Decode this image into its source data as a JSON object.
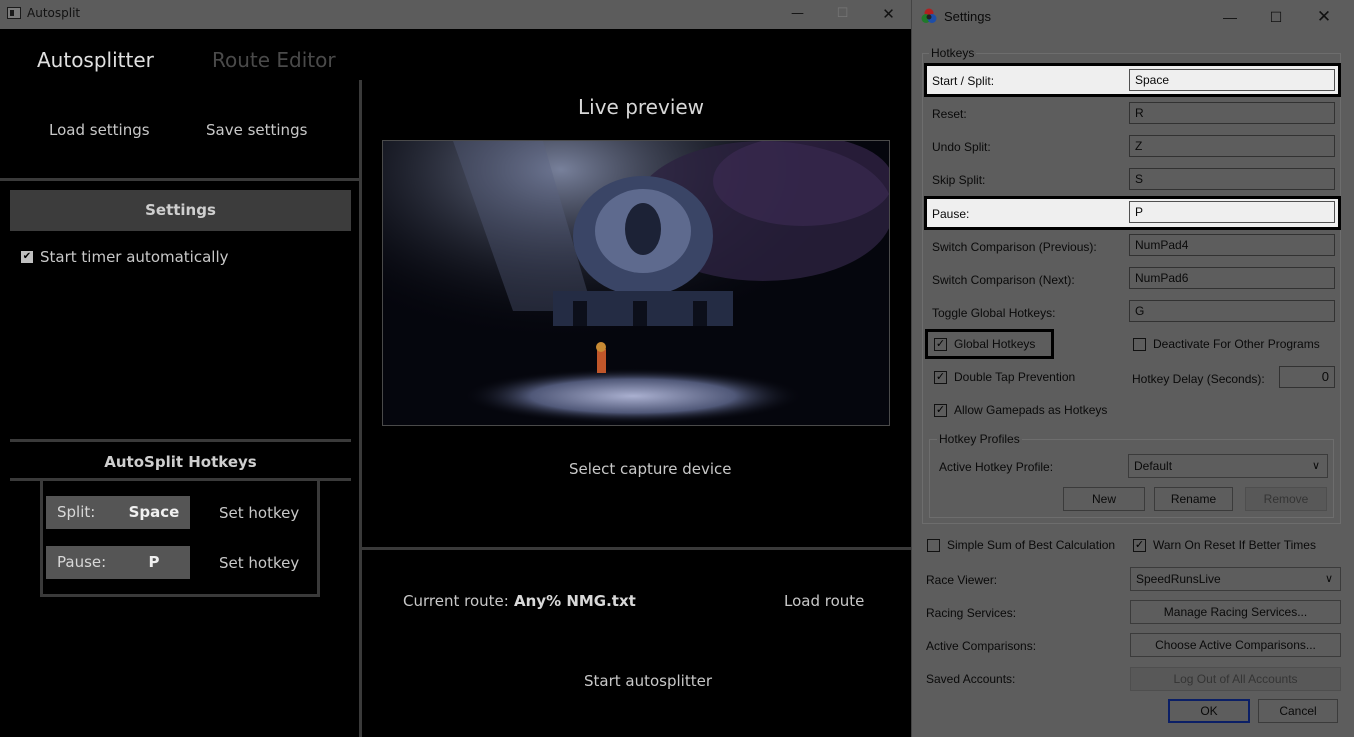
{
  "autosplit": {
    "window_title": "Autosplit",
    "tabs": {
      "autosplitter": "Autosplitter",
      "route_editor": "Route Editor"
    },
    "load_settings": "Load settings",
    "save_settings": "Save settings",
    "settings_header": "Settings",
    "start_timer_automatically": "Start timer automatically",
    "hotkeys_title": "AutoSplit Hotkeys",
    "hotkeys": {
      "split_label": "Split:",
      "split_value": "Space",
      "pause_label": "Pause:",
      "pause_value": "P",
      "set_hotkey": "Set hotkey"
    },
    "live_preview": "Live preview",
    "select_capture_device": "Select capture device",
    "current_route_label": "Current route:",
    "current_route_value": "Any% NMG.txt",
    "load_route": "Load route",
    "start_autosplitter": "Start autosplitter"
  },
  "settings_dialog": {
    "window_title": "Settings",
    "hotkeys_group": "Hotkeys",
    "rows": [
      {
        "label": "Start / Split:",
        "value": "Space"
      },
      {
        "label": "Reset:",
        "value": "R"
      },
      {
        "label": "Undo Split:",
        "value": "Z"
      },
      {
        "label": "Skip Split:",
        "value": "S"
      },
      {
        "label": "Pause:",
        "value": "P"
      },
      {
        "label": "Switch Comparison (Previous):",
        "value": "NumPad4"
      },
      {
        "label": "Switch Comparison (Next):",
        "value": "NumPad6"
      },
      {
        "label": "Toggle Global Hotkeys:",
        "value": "G"
      }
    ],
    "global_hotkeys": "Global Hotkeys",
    "deactivate_other": "Deactivate For Other Programs",
    "double_tap": "Double Tap Prevention",
    "hotkey_delay_label": "Hotkey Delay (Seconds):",
    "hotkey_delay_value": "0",
    "allow_gamepads": "Allow Gamepads as Hotkeys",
    "hotkey_profiles_group": "Hotkey Profiles",
    "active_profile_label": "Active Hotkey Profile:",
    "active_profile_value": "Default",
    "btn_new": "New",
    "btn_rename": "Rename",
    "btn_remove": "Remove",
    "simple_sum": "Simple Sum of Best Calculation",
    "warn_reset": "Warn On Reset If Better Times",
    "race_viewer_label": "Race Viewer:",
    "race_viewer_value": "SpeedRunsLive",
    "racing_services_label": "Racing Services:",
    "racing_services_btn": "Manage Racing Services...",
    "active_comparisons_label": "Active Comparisons:",
    "active_comparisons_btn": "Choose Active Comparisons...",
    "saved_accounts_label": "Saved Accounts:",
    "saved_accounts_btn": "Log Out of All Accounts",
    "ok": "OK",
    "cancel": "Cancel"
  }
}
